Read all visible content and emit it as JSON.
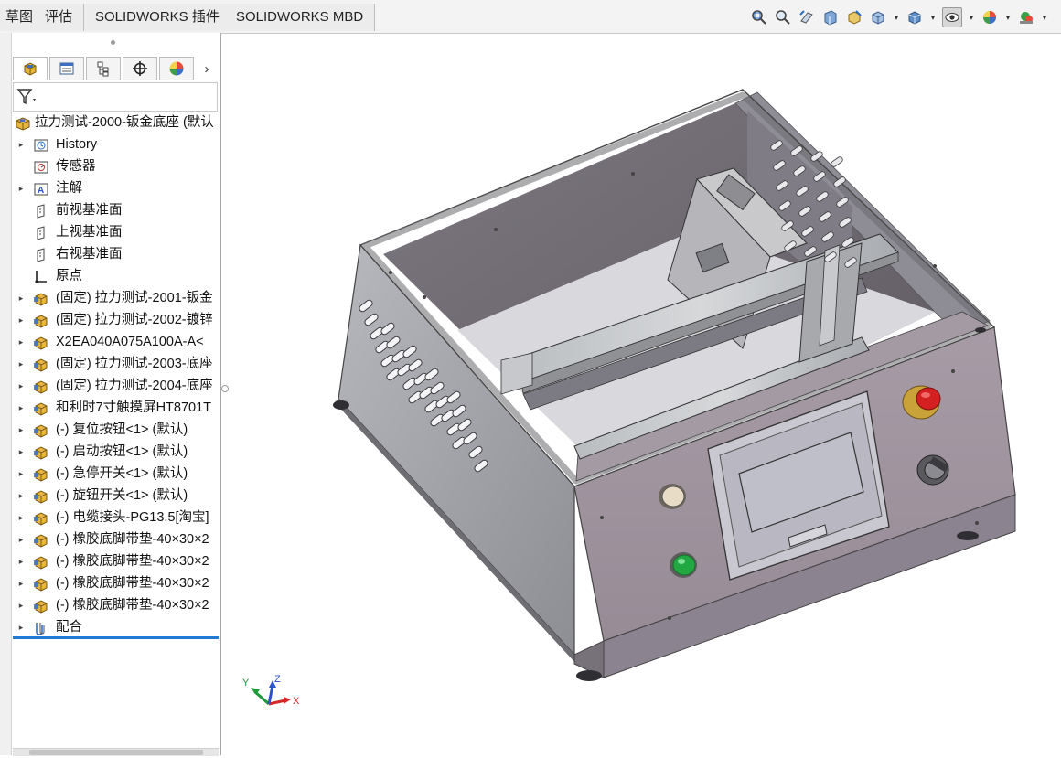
{
  "tabs": [
    {
      "label": "草图"
    },
    {
      "label": "评估"
    },
    {
      "label": "SOLIDWORKS 插件"
    },
    {
      "label": "SOLIDWORKS MBD"
    }
  ],
  "view_toolbar": {
    "icons": [
      "zoom-to-fit-icon",
      "zoom-to-area-icon",
      "previous-view-icon",
      "section-view-icon",
      "dynamic-annotation-icon",
      "view-orientation-icon",
      "display-style-icon",
      "hide-show-items-icon",
      "edit-appearance-icon",
      "apply-scene-icon"
    ]
  },
  "panel": {
    "tabs": [
      "featuremanager-icon",
      "propertymanager-icon",
      "configurationmanager-icon",
      "dimxpert-icon",
      "display-manager-icon"
    ],
    "more": "›",
    "filter_icon": "filter-icon"
  },
  "tree": {
    "root": {
      "label": "拉力测试-2000-钣金底座  (默认"
    },
    "items": [
      {
        "label": "History",
        "icon": "history-icon",
        "expandable": true
      },
      {
        "label": "传感器",
        "icon": "sensor-icon",
        "expandable": false
      },
      {
        "label": "注解",
        "icon": "annotation-icon",
        "expandable": true
      },
      {
        "label": "前视基准面",
        "icon": "plane-icon",
        "expandable": false
      },
      {
        "label": "上视基准面",
        "icon": "plane-icon",
        "expandable": false
      },
      {
        "label": "右视基准面",
        "icon": "plane-icon",
        "expandable": false
      },
      {
        "label": "原点",
        "icon": "origin-icon",
        "expandable": false
      },
      {
        "label": "(固定) 拉力测试-2001-钣金",
        "icon": "part-icon",
        "expandable": true
      },
      {
        "label": "(固定) 拉力测试-2002-镀锌",
        "icon": "part-icon",
        "expandable": true
      },
      {
        "label": "X2EA040A075A100A-A<",
        "icon": "part-icon",
        "expandable": true
      },
      {
        "label": "(固定) 拉力测试-2003-底座",
        "icon": "part-icon",
        "expandable": true
      },
      {
        "label": "(固定) 拉力测试-2004-底座",
        "icon": "part-icon",
        "expandable": true
      },
      {
        "label": "和利时7寸触摸屏HT8701T",
        "icon": "part-icon",
        "expandable": true
      },
      {
        "label": "(-) 复位按钮<1> (默认)",
        "icon": "part-icon",
        "expandable": true
      },
      {
        "label": "(-) 启动按钮<1> (默认)",
        "icon": "part-icon",
        "expandable": true
      },
      {
        "label": "(-) 急停开关<1> (默认)",
        "icon": "part-icon",
        "expandable": true
      },
      {
        "label": "(-) 旋钮开关<1> (默认)",
        "icon": "part-icon",
        "expandable": true
      },
      {
        "label": "(-) 电缆接头-PG13.5[淘宝]",
        "icon": "part-icon",
        "expandable": true
      },
      {
        "label": "(-) 橡胶底脚带垫-40×30×2",
        "icon": "part-icon",
        "expandable": true
      },
      {
        "label": "(-) 橡胶底脚带垫-40×30×2",
        "icon": "part-icon",
        "expandable": true
      },
      {
        "label": "(-) 橡胶底脚带垫-40×30×2",
        "icon": "part-icon",
        "expandable": true
      },
      {
        "label": "(-) 橡胶底脚带垫-40×30×2",
        "icon": "part-icon",
        "expandable": true
      },
      {
        "label": "配合",
        "icon": "mates-icon",
        "expandable": true
      }
    ]
  },
  "triad": {
    "x": "X",
    "y": "Y",
    "z": "Z"
  },
  "colors": {
    "tab_bg": "#ececec",
    "sheet_metal": "#9a9aa0",
    "panel_face": "#9c9099",
    "inner_dark": "#6e6970",
    "button_green": "#22a842",
    "button_red": "#d42020",
    "selection": "#1f7bd6"
  }
}
